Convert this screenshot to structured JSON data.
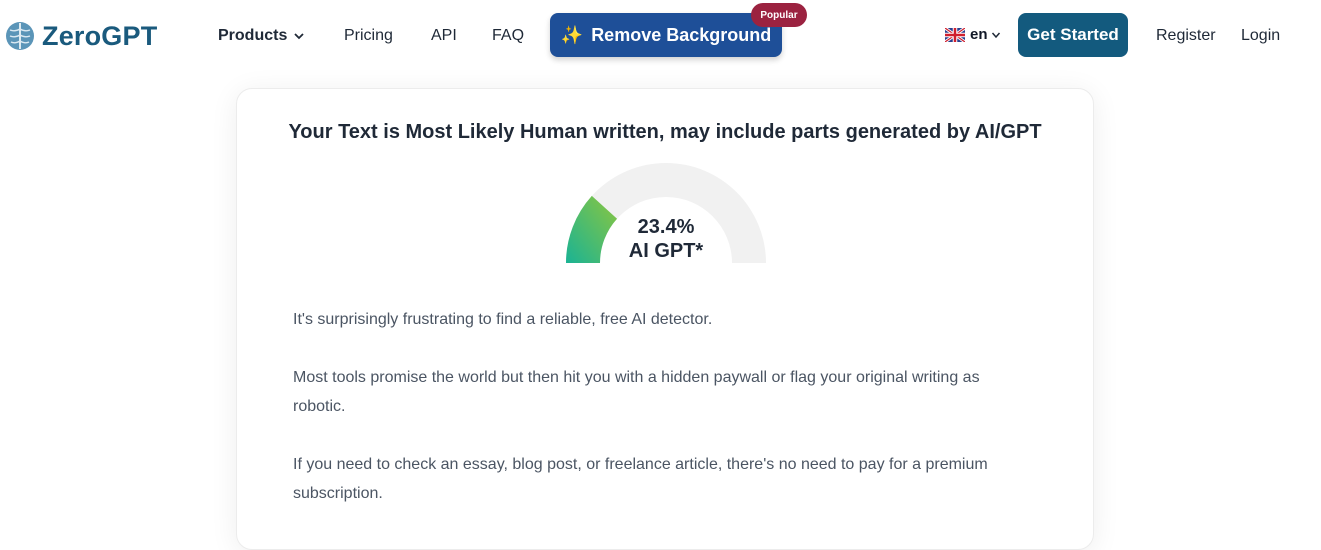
{
  "brand": {
    "name": "ZeroGPT"
  },
  "nav": {
    "products": "Products",
    "pricing": "Pricing",
    "api": "API",
    "faq": "FAQ",
    "remove_background": "Remove Background",
    "popular_badge": "Popular",
    "language": "en",
    "get_started": "Get Started",
    "register": "Register",
    "login": "Login"
  },
  "result": {
    "title": "Your Text is Most Likely Human written, may include parts generated by AI/GPT",
    "gauge": {
      "percent_text": "23.4%",
      "label": "AI GPT*",
      "fraction": 0.234
    },
    "paragraphs": [
      "It's surprisingly frustrating to find a reliable, free AI detector.",
      "Most tools promise the world but then hit you with a hidden paywall or flag your original writing as robotic.",
      "If you need to check an essay, blog post, or freelance article, there's no need to pay for a premium subscription."
    ]
  },
  "colors": {
    "brand": "#1a5a7d",
    "remove_bg_button": "#1e4f98",
    "popular_badge": "#9b2240",
    "get_started_button": "#135a7e",
    "gauge_track": "#f1f1f1",
    "gauge_start": "#1ab394",
    "gauge_end": "#8cc63f"
  },
  "icons": {
    "logo": "brain-icon",
    "remove_background": "sparkle-icon",
    "language": "uk-flag-icon",
    "dropdown": "chevron-down-icon"
  }
}
